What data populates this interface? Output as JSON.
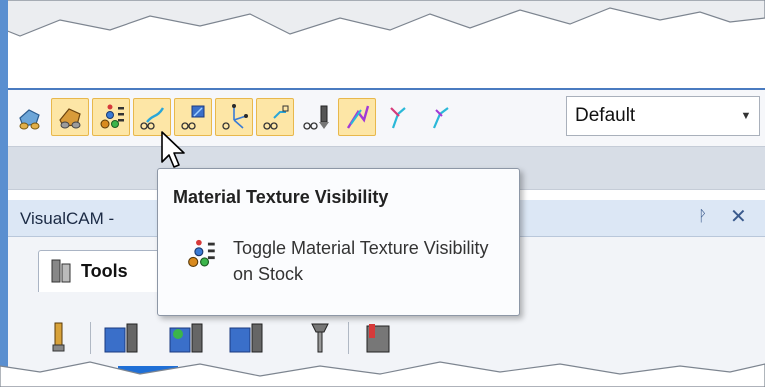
{
  "toolbar": {
    "buttons": [
      {
        "icon": "shaded-view-icon",
        "active": false
      },
      {
        "icon": "shaded-stock-icon",
        "active": true
      },
      {
        "icon": "material-texture-icon",
        "active": true
      },
      {
        "icon": "toolpath-display-icon",
        "active": true
      },
      {
        "icon": "stock-display-icon",
        "active": true
      },
      {
        "icon": "toolpath-axis-icon",
        "active": true
      },
      {
        "icon": "toolpath-links-icon",
        "active": true
      },
      {
        "icon": "tool-display-icon",
        "active": false
      },
      {
        "icon": "feed-moves-icon",
        "active": true
      },
      {
        "icon": "rapid-moves-icon",
        "active": false
      },
      {
        "icon": "lead-moves-icon",
        "active": false
      }
    ],
    "combo_value": "Default",
    "active_color": "#fde6a6"
  },
  "panel": {
    "title": "VisualCAM -",
    "tab_label": "Tools"
  },
  "tooltip": {
    "title": "Material Texture Visibility",
    "description": "Toggle Material Texture Visibility on Stock"
  }
}
